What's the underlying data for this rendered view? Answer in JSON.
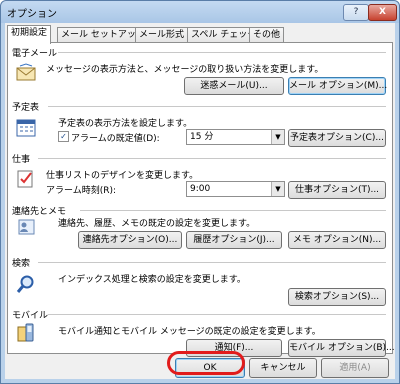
{
  "window": {
    "title": "オプション",
    "help_label": "?",
    "close_label": "X"
  },
  "tabs": [
    {
      "label": "初期設定",
      "active": true
    },
    {
      "label": "メール セットアップ"
    },
    {
      "label": "メール形式"
    },
    {
      "label": "スペル チェック"
    },
    {
      "label": "その他"
    }
  ],
  "sections": {
    "mail": {
      "title": "電子メール",
      "description": "メッセージの表示方法と、メッセージの取り扱い方法を変更します。",
      "button1": "迷惑メール(U)...",
      "button2": "メール オプション(M)..."
    },
    "calendar": {
      "title": "予定表",
      "description": "予定表の表示方法を設定します。",
      "checkbox_label": "アラームの既定値(D):",
      "checkbox_checked": "✓",
      "select_value": "15 分",
      "button": "予定表オプション(C)..."
    },
    "tasks": {
      "title": "仕事",
      "description": "仕事リストのデザインを変更します。",
      "alarm_label": "アラーム時刻(R):",
      "select_value": "9:00",
      "button": "仕事オプション(T)..."
    },
    "contacts": {
      "title": "連絡先とメモ",
      "description": "連絡先、履歴、メモの既定の設定を変更します。",
      "button1": "連絡先オプション(O)...",
      "button2": "履歴オプション(J)...",
      "button3": "メモ オプション(N)..."
    },
    "search": {
      "title": "検索",
      "description": "インデックス処理と検索の設定を変更します。",
      "button": "検索オプション(S)..."
    },
    "mobile": {
      "title": "モバイル",
      "description": "モバイル通知とモバイル メッセージの既定の設定を変更します。",
      "button1": "通知(F)...",
      "button2": "モバイル オプション(B)..."
    }
  },
  "footer": {
    "ok": "OK",
    "cancel": "キャンセル",
    "apply": "適用(A)"
  },
  "colors": {
    "highlight": "#e11c1c"
  }
}
